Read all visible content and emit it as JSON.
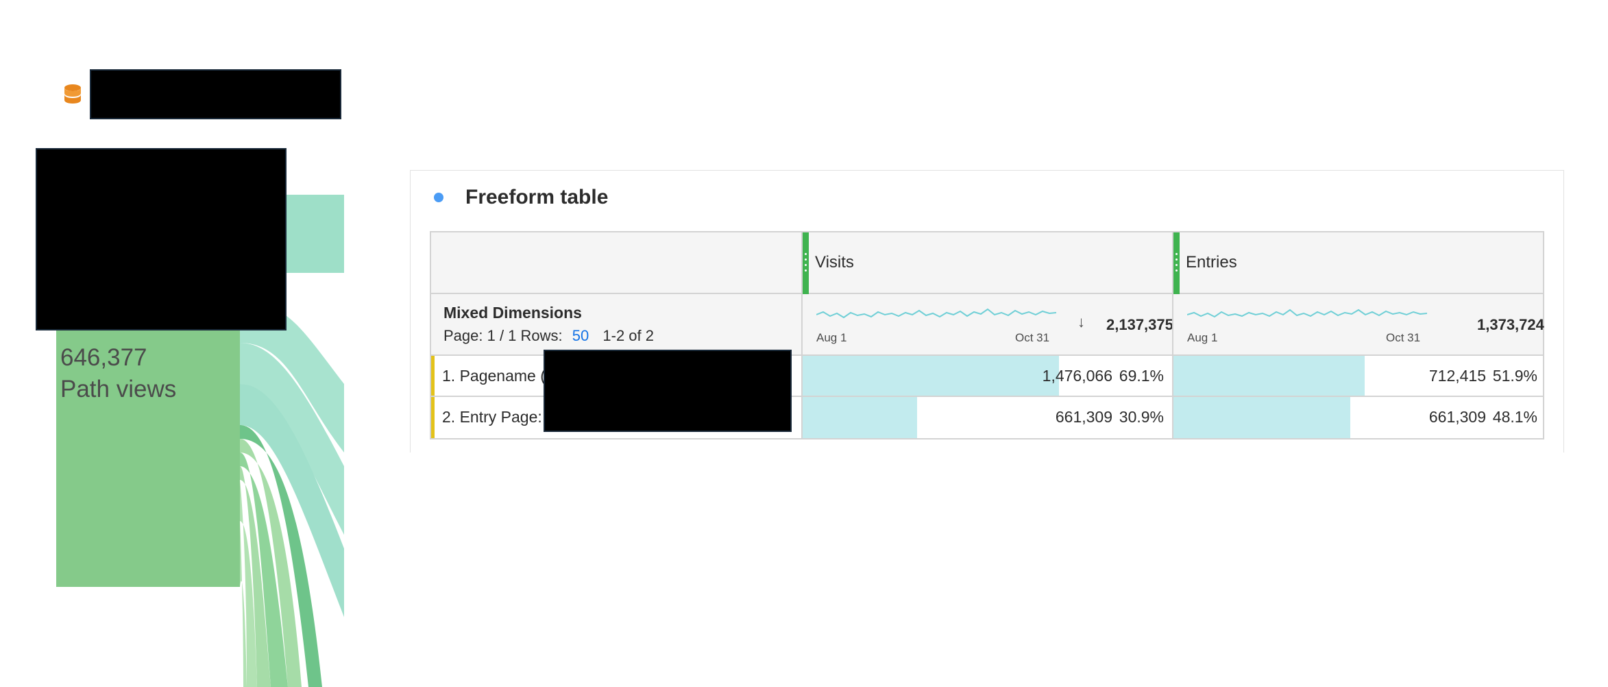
{
  "flow": {
    "node_count": "646,377",
    "node_label": "Path views",
    "icon": "database-icon"
  },
  "panel": {
    "title": "Freeform table",
    "columns": [
      {
        "name": "Visits",
        "total": "2,137,375",
        "spark_start": "Aug 1",
        "spark_end": "Oct 31",
        "sort": "descending"
      },
      {
        "name": "Entries",
        "total": "1,373,724",
        "spark_start": "Aug 1",
        "spark_end": "Oct 31"
      }
    ],
    "dimension": {
      "title": "Mixed Dimensions",
      "page_text": "Page: 1 / 1  Rows:",
      "rows_value": "50",
      "range_text": "1-2 of 2"
    },
    "rows": [
      {
        "label": "1.  Pagename (",
        "visits": "1,476,066",
        "visits_pct": "69.1%",
        "visits_share": 0.691,
        "entries": "712,415",
        "entries_pct": "51.9%",
        "entries_share": 0.519
      },
      {
        "label": "2.  Entry Page:",
        "visits": "661,309",
        "visits_pct": "30.9%",
        "visits_share": 0.309,
        "entries": "661,309",
        "entries_pct": "48.1%",
        "entries_share": 0.481
      }
    ],
    "colors": {
      "accent": "#3fb34f",
      "bar": "#c2ebee",
      "row_marker": "#e3c21a",
      "link": "#1473e6"
    }
  }
}
